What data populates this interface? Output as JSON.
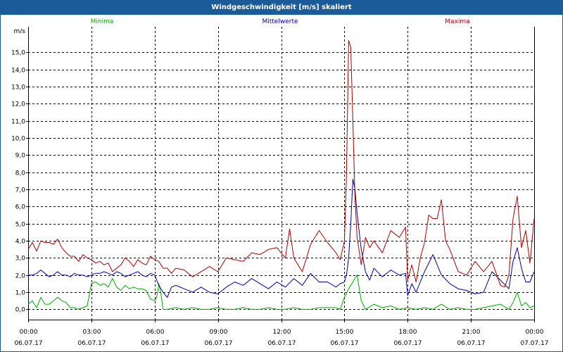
{
  "window": {
    "title": "Windgeschwindigkeit [m/s] skaliert"
  },
  "chart_data": {
    "type": "line",
    "title": "Windgeschwindigkeit [m/s] skaliert",
    "ylabel": "m/s",
    "xlabel": "",
    "ylim": [
      -0.6,
      16.5
    ],
    "xlim": [
      0,
      24
    ],
    "grid": true,
    "legend_position": "top",
    "y_ticks": [
      "0,0",
      "1,0",
      "2,0",
      "3,0",
      "4,0",
      "5,0",
      "6,0",
      "7,0",
      "8,0",
      "9,0",
      "10,0",
      "11,0",
      "12,0",
      "13,0",
      "14,0",
      "15,0"
    ],
    "x_ticks": [
      {
        "time": "00:00",
        "date": "06.07.17"
      },
      {
        "time": "03:00",
        "date": "06.07.17"
      },
      {
        "time": "06:00",
        "date": "06.07.17"
      },
      {
        "time": "09:00",
        "date": "06.07.17"
      },
      {
        "time": "12:00",
        "date": "06.07.17"
      },
      {
        "time": "15:00",
        "date": "06.07.17"
      },
      {
        "time": "18:00",
        "date": "06.07.17"
      },
      {
        "time": "21:00",
        "date": "06.07.17"
      },
      {
        "time": "00:00",
        "date": "07.07.17"
      }
    ],
    "series": [
      {
        "name": "Minima",
        "color": "#00aa00",
        "x": [
          0,
          0.2,
          0.4,
          0.6,
          0.8,
          1.0,
          1.2,
          1.4,
          1.6,
          1.8,
          2.0,
          2.2,
          2.4,
          2.6,
          2.8,
          3.0,
          3.2,
          3.4,
          3.6,
          3.8,
          4.0,
          4.2,
          4.4,
          4.6,
          4.8,
          5.0,
          5.2,
          5.4,
          5.6,
          5.8,
          6.0,
          6.1,
          6.2,
          6.3,
          6.4,
          6.5,
          6.6,
          7.0,
          7.4,
          7.8,
          8.2,
          8.6,
          9.0,
          9.4,
          9.8,
          10.2,
          10.6,
          11.0,
          11.4,
          11.8,
          12.2,
          12.6,
          13.0,
          13.4,
          13.8,
          14.2,
          14.6,
          14.8,
          15.0,
          15.2,
          15.4,
          15.6,
          15.8,
          16.0,
          16.4,
          16.8,
          17.2,
          17.6,
          18.0,
          18.4,
          18.8,
          19.2,
          19.6,
          20.0,
          20.4,
          20.8,
          21.2,
          21.6,
          22.0,
          22.4,
          22.8,
          23.0,
          23.2,
          23.4,
          23.6,
          23.8,
          24.0
        ],
        "y": [
          0.3,
          0.5,
          0.1,
          0.7,
          0.3,
          0.3,
          0.5,
          0.7,
          0.5,
          0.4,
          0.1,
          0.1,
          0.0,
          0.1,
          0.2,
          1.5,
          1.6,
          1.4,
          1.5,
          1.3,
          1.8,
          1.3,
          1.1,
          1.4,
          1.2,
          1.3,
          1.2,
          1.2,
          1.1,
          0.6,
          0.5,
          0.7,
          1.5,
          0.9,
          0.0,
          0.0,
          0.0,
          0.1,
          0.0,
          0.1,
          0.0,
          0.0,
          0.1,
          0.0,
          0.0,
          0.1,
          0.0,
          0.0,
          0.1,
          0.0,
          0.0,
          0.1,
          0.0,
          0.0,
          0.1,
          0.1,
          0.1,
          0.0,
          0.7,
          1.2,
          1.6,
          2.0,
          0.5,
          0.0,
          0.3,
          0.1,
          0.2,
          0.0,
          0.1,
          0.0,
          0.1,
          0.0,
          0.3,
          0.0,
          0.1,
          0.0,
          0.0,
          0.1,
          0.2,
          0.3,
          0.0,
          0.4,
          1.0,
          0.2,
          0.4,
          0.1,
          0.2
        ]
      },
      {
        "name": "Mittelwerte",
        "color": "#0000aa",
        "x": [
          0,
          0.2,
          0.4,
          0.6,
          0.8,
          1.0,
          1.2,
          1.4,
          1.6,
          1.8,
          2.0,
          2.2,
          2.4,
          2.6,
          2.8,
          3.0,
          3.2,
          3.4,
          3.6,
          3.8,
          4.0,
          4.2,
          4.4,
          4.6,
          4.8,
          5.0,
          5.2,
          5.4,
          5.6,
          5.8,
          6.0,
          6.2,
          6.4,
          6.6,
          6.8,
          7.0,
          7.4,
          7.8,
          8.2,
          8.6,
          9.0,
          9.4,
          9.8,
          10.2,
          10.6,
          11.0,
          11.4,
          11.8,
          12.2,
          12.6,
          13.0,
          13.4,
          13.8,
          14.2,
          14.6,
          14.8,
          15.0,
          15.1,
          15.2,
          15.3,
          15.4,
          15.5,
          15.6,
          15.8,
          16.0,
          16.2,
          16.4,
          16.8,
          17.2,
          17.6,
          17.9,
          18.0,
          18.2,
          18.4,
          18.8,
          19.2,
          19.6,
          20.0,
          20.4,
          20.8,
          21.2,
          21.6,
          22.0,
          22.4,
          22.8,
          23.0,
          23.2,
          23.4,
          23.6,
          23.8,
          24.0
        ],
        "y": [
          2.0,
          2.0,
          2.1,
          2.3,
          2.1,
          1.9,
          2.0,
          2.2,
          2.0,
          2.0,
          1.9,
          2.1,
          2.0,
          2.0,
          1.9,
          2.0,
          2.1,
          2.1,
          2.2,
          2.1,
          2.0,
          2.2,
          2.1,
          1.9,
          2.0,
          2.1,
          2.2,
          2.0,
          1.9,
          2.1,
          2.0,
          1.4,
          1.0,
          0.7,
          1.3,
          1.4,
          1.2,
          1.0,
          1.3,
          1.0,
          0.9,
          1.3,
          1.6,
          1.4,
          1.8,
          1.5,
          1.2,
          1.6,
          1.3,
          1.8,
          1.4,
          2.1,
          1.6,
          1.6,
          1.3,
          1.5,
          1.6,
          2.0,
          3.0,
          5.0,
          7.6,
          7.0,
          5.6,
          3.5,
          2.2,
          1.7,
          2.4,
          1.9,
          2.3,
          2.0,
          2.1,
          0.8,
          1.5,
          1.0,
          2.2,
          3.2,
          2.0,
          1.5,
          1.2,
          1.1,
          0.9,
          1.0,
          2.2,
          1.7,
          1.2,
          2.8,
          3.6,
          2.4,
          1.6,
          1.6,
          2.2
        ]
      },
      {
        "name": "Maxima",
        "color": "#aa0000",
        "x": [
          0,
          0.2,
          0.4,
          0.6,
          0.8,
          1.0,
          1.2,
          1.4,
          1.6,
          1.8,
          2.0,
          2.2,
          2.4,
          2.6,
          2.8,
          3.0,
          3.2,
          3.4,
          3.6,
          3.8,
          4.0,
          4.2,
          4.4,
          4.6,
          4.8,
          5.0,
          5.2,
          5.4,
          5.6,
          5.8,
          6.0,
          6.2,
          6.4,
          6.6,
          6.8,
          7.0,
          7.4,
          7.8,
          8.2,
          8.6,
          9.0,
          9.4,
          9.8,
          10.2,
          10.6,
          11.0,
          11.4,
          11.8,
          12.2,
          12.4,
          12.6,
          12.8,
          13.0,
          13.4,
          13.8,
          14.2,
          14.6,
          14.8,
          15.0,
          15.1,
          15.2,
          15.3,
          15.4,
          15.5,
          15.6,
          15.8,
          16.0,
          16.2,
          16.4,
          16.8,
          17.2,
          17.6,
          17.9,
          18.0,
          18.2,
          18.4,
          18.6,
          18.8,
          19.0,
          19.2,
          19.4,
          19.6,
          19.8,
          20.0,
          20.4,
          20.8,
          21.2,
          21.6,
          22.0,
          22.4,
          22.6,
          22.8,
          23.0,
          23.2,
          23.4,
          23.6,
          23.8,
          24.0
        ],
        "y": [
          3.5,
          3.9,
          3.4,
          4.0,
          3.9,
          3.9,
          3.8,
          4.1,
          3.6,
          3.3,
          3.1,
          3.1,
          2.8,
          3.2,
          3.0,
          2.9,
          2.7,
          2.8,
          2.6,
          2.7,
          2.2,
          2.4,
          2.6,
          3.0,
          2.8,
          2.5,
          2.9,
          2.7,
          2.6,
          3.1,
          2.9,
          2.8,
          2.4,
          2.4,
          2.1,
          2.4,
          2.3,
          1.9,
          2.2,
          2.5,
          2.2,
          3.0,
          2.9,
          2.8,
          3.3,
          3.2,
          3.5,
          3.6,
          3.0,
          4.7,
          3.0,
          2.6,
          2.2,
          3.8,
          4.6,
          3.9,
          3.3,
          2.9,
          4.0,
          8.0,
          15.7,
          15.3,
          11.0,
          6.5,
          4.2,
          2.6,
          4.2,
          3.6,
          4.0,
          3.3,
          4.6,
          4.2,
          4.8,
          1.7,
          2.6,
          1.6,
          3.0,
          3.9,
          5.5,
          5.3,
          5.3,
          6.4,
          4.0,
          3.5,
          2.2,
          2.0,
          2.8,
          2.2,
          2.8,
          1.4,
          1.3,
          2.0,
          5.3,
          6.6,
          3.6,
          4.6,
          2.7,
          5.3
        ]
      }
    ]
  }
}
